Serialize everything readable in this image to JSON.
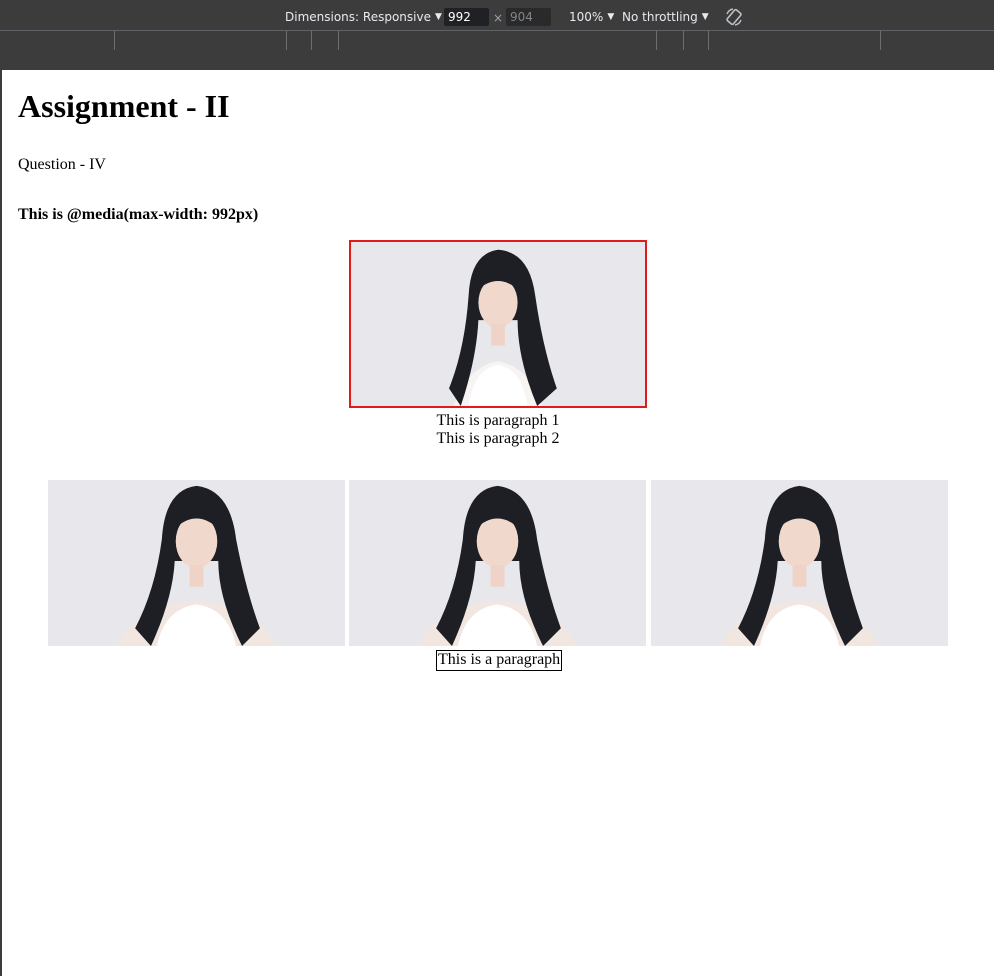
{
  "devtools": {
    "dimensions_label": "Dimensions: Responsive",
    "width_value": "992",
    "height_value": "904",
    "times": "×",
    "zoom": "100%",
    "throttling": "No throttling",
    "rotate_icon": "rotate-icon"
  },
  "page": {
    "title": "Assignment - II",
    "question": "Question - IV",
    "media_note": "This is @media(max-width: 992px)",
    "paragraph1": "This is paragraph 1",
    "paragraph2": "This is paragraph 2",
    "bottom_paragraph": "This is a paragraph"
  },
  "colors": {
    "featured_border": "#e01b1b",
    "toolbar_bg": "#3c3c3c"
  }
}
